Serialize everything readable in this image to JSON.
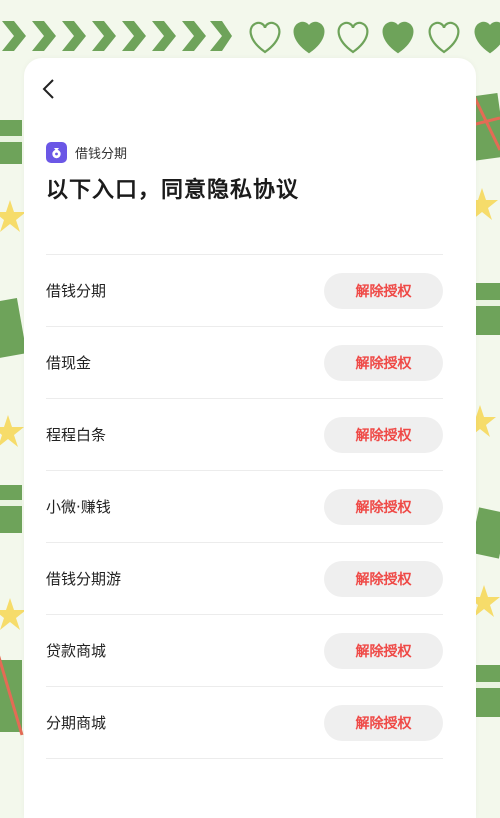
{
  "header": {
    "back_icon": "chevron-left-icon",
    "brand_icon": "money-bag-icon",
    "brand_name": "借钱分期",
    "title": "以下入口，同意隐私协议"
  },
  "colors": {
    "accent_red": "#ef4a47",
    "brand_purple": "#6b57e6",
    "decor_green": "#6ea35a",
    "decor_star": "#f6dc6a"
  },
  "entries": [
    {
      "name": "借钱分期",
      "action": "解除授权"
    },
    {
      "name": "借现金",
      "action": "解除授权"
    },
    {
      "name": "程程白条",
      "action": "解除授权"
    },
    {
      "name": "小微·赚钱",
      "action": "解除授权"
    },
    {
      "name": "借钱分期游",
      "action": "解除授权"
    },
    {
      "name": "贷款商城",
      "action": "解除授权"
    },
    {
      "name": "分期商城",
      "action": "解除授权"
    }
  ]
}
